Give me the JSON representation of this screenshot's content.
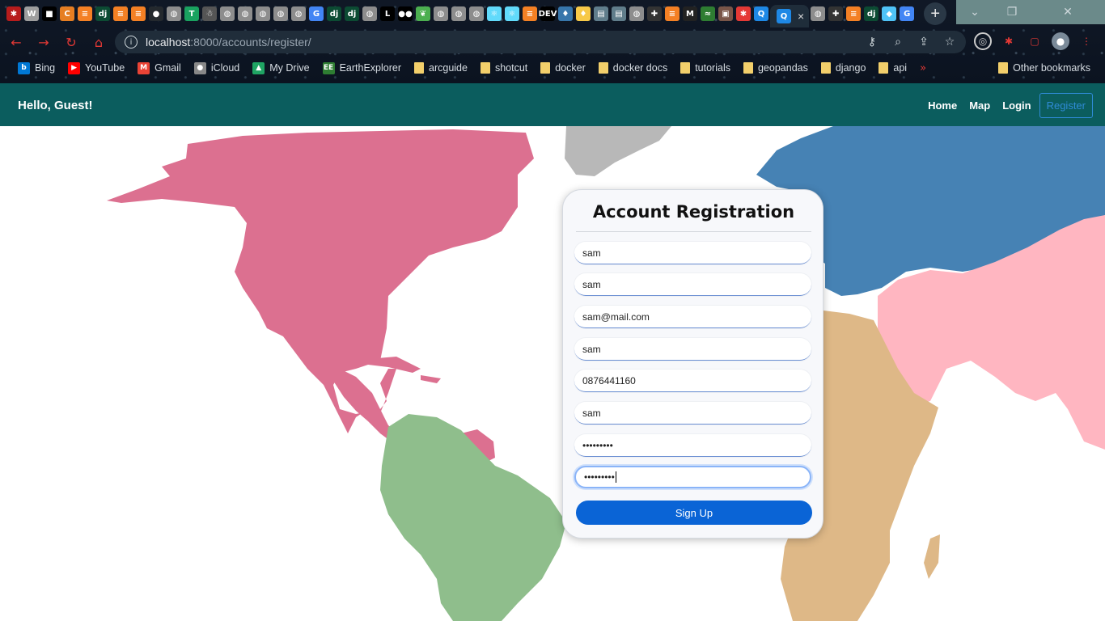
{
  "browser": {
    "tab_icons": [
      {
        "icon": "pin-icon",
        "color": "#b71c1c",
        "glyph": "✱"
      },
      {
        "icon": "wolfram-icon",
        "color": "#9e9e9e",
        "glyph": "W"
      },
      {
        "icon": "square-icon",
        "color": "#000000",
        "glyph": "■"
      },
      {
        "icon": "c-icon",
        "color": "#e67e22",
        "glyph": "C"
      },
      {
        "icon": "stackoverflow-icon",
        "color": "#f48024",
        "glyph": "≡"
      },
      {
        "icon": "django-icon",
        "color": "#0c4b33",
        "glyph": "dj"
      },
      {
        "icon": "stackoverflow-icon",
        "color": "#f48024",
        "glyph": "≡"
      },
      {
        "icon": "stackoverflow-icon",
        "color": "#f48024",
        "glyph": "≡"
      },
      {
        "icon": "github-icon",
        "color": "#24292e",
        "glyph": "●"
      },
      {
        "icon": "globe-icon",
        "color": "#8d8d8d",
        "glyph": "◍"
      },
      {
        "icon": "t-icon",
        "color": "#1aa260",
        "glyph": "T"
      },
      {
        "icon": "ghost-icon",
        "color": "#555555",
        "glyph": "☃"
      },
      {
        "icon": "globe-icon",
        "color": "#8d8d8d",
        "glyph": "◍"
      },
      {
        "icon": "globe-icon",
        "color": "#8d8d8d",
        "glyph": "◍"
      },
      {
        "icon": "globe-icon",
        "color": "#8d8d8d",
        "glyph": "◍"
      },
      {
        "icon": "globe-icon",
        "color": "#8d8d8d",
        "glyph": "◍"
      },
      {
        "icon": "globe-icon",
        "color": "#8d8d8d",
        "glyph": "◍"
      },
      {
        "icon": "google-icon",
        "color": "#4285f4",
        "glyph": "G"
      },
      {
        "icon": "django-icon",
        "color": "#0c4b33",
        "glyph": "dj"
      },
      {
        "icon": "django-icon",
        "color": "#0c4b33",
        "glyph": "dj"
      },
      {
        "icon": "globe-icon",
        "color": "#8d8d8d",
        "glyph": "◍"
      },
      {
        "icon": "l-icon",
        "color": "#000000",
        "glyph": "L"
      },
      {
        "icon": "medium-icon",
        "color": "#000000",
        "glyph": "●●"
      },
      {
        "icon": "leaf-icon",
        "color": "#4caf50",
        "glyph": "❦"
      },
      {
        "icon": "globe-icon",
        "color": "#8d8d8d",
        "glyph": "◍"
      },
      {
        "icon": "globe-icon",
        "color": "#8d8d8d",
        "glyph": "◍"
      },
      {
        "icon": "globe-icon",
        "color": "#8d8d8d",
        "glyph": "◍"
      },
      {
        "icon": "react-icon",
        "color": "#61dafb",
        "glyph": "⚛"
      },
      {
        "icon": "react-icon",
        "color": "#61dafb",
        "glyph": "⚛"
      },
      {
        "icon": "stackoverflow-icon",
        "color": "#f48024",
        "glyph": "≡"
      },
      {
        "icon": "dev-icon",
        "color": "#000000",
        "glyph": "DEV"
      },
      {
        "icon": "python-icon",
        "color": "#3776ab",
        "glyph": "♦"
      },
      {
        "icon": "python-icon",
        "color": "#f7c948",
        "glyph": "♦"
      },
      {
        "icon": "book-icon",
        "color": "#607d8b",
        "glyph": "▤"
      },
      {
        "icon": "book-icon",
        "color": "#607d8b",
        "glyph": "▤"
      },
      {
        "icon": "globe-icon",
        "color": "#8d8d8d",
        "glyph": "◍"
      },
      {
        "icon": "puzzle-icon",
        "color": "#ffffff",
        "glyph": "✚"
      },
      {
        "icon": "stackoverflow-icon",
        "color": "#f48024",
        "glyph": "≡"
      },
      {
        "icon": "m-icon",
        "color": "#222222",
        "glyph": "M"
      },
      {
        "icon": "leaf-icon",
        "color": "#2e7d32",
        "glyph": "≈"
      },
      {
        "icon": "image-icon",
        "color": "#795548",
        "glyph": "▣"
      },
      {
        "icon": "pin-icon",
        "color": "#e53935",
        "glyph": "✱"
      },
      {
        "icon": "q-icon",
        "color": "#1e88e5",
        "glyph": "Q"
      }
    ],
    "tab_icons_after": [
      {
        "icon": "globe-icon",
        "color": "#8d8d8d",
        "glyph": "◍"
      },
      {
        "icon": "puzzle-icon",
        "color": "#ffffff",
        "glyph": "✚"
      },
      {
        "icon": "stackoverflow-icon",
        "color": "#f48024",
        "glyph": "≡"
      },
      {
        "icon": "django-icon",
        "color": "#0c4b33",
        "glyph": "dj"
      },
      {
        "icon": "cube-icon",
        "color": "#4fc3f7",
        "glyph": "◆"
      },
      {
        "icon": "google-icon",
        "color": "#4285f4",
        "glyph": "G"
      }
    ],
    "active_tab_close": "×",
    "new_tab": "+",
    "window_controls": {
      "minimize": "⌄",
      "restore": "❐",
      "close": "✕"
    },
    "url_host": "localhost",
    "url_path": ":8000/accounts/register/",
    "bookmarks": [
      {
        "label": "Bing",
        "icon": "bing-icon",
        "color": "#0078d4",
        "glyph": "b"
      },
      {
        "label": "YouTube",
        "icon": "youtube-icon",
        "color": "#ff0000",
        "glyph": "▶"
      },
      {
        "label": "Gmail",
        "icon": "gmail-icon",
        "color": "#ea4335",
        "glyph": "M"
      },
      {
        "label": "iCloud",
        "icon": "apple-icon",
        "color": "#888888",
        "glyph": "●"
      },
      {
        "label": "My Drive",
        "icon": "drive-icon",
        "color": "#1fa463",
        "glyph": "▲"
      },
      {
        "label": "EarthExplorer",
        "icon": "ee-icon",
        "color": "#2e7d32",
        "glyph": "EE"
      },
      {
        "label": "arcguide",
        "icon": "folder-icon",
        "color": "#f2cf6b",
        "glyph": ""
      },
      {
        "label": "shotcut",
        "icon": "folder-icon",
        "color": "#f2cf6b",
        "glyph": ""
      },
      {
        "label": "docker",
        "icon": "folder-icon",
        "color": "#f2cf6b",
        "glyph": ""
      },
      {
        "label": "docker docs",
        "icon": "folder-icon",
        "color": "#f2cf6b",
        "glyph": ""
      },
      {
        "label": "tutorials",
        "icon": "folder-icon",
        "color": "#f2cf6b",
        "glyph": ""
      },
      {
        "label": "geopandas",
        "icon": "folder-icon",
        "color": "#f2cf6b",
        "glyph": ""
      },
      {
        "label": "django",
        "icon": "folder-icon",
        "color": "#f2cf6b",
        "glyph": ""
      },
      {
        "label": "api",
        "icon": "folder-icon",
        "color": "#f2cf6b",
        "glyph": ""
      }
    ],
    "bookmarks_more": "»",
    "other_bookmarks": "Other bookmarks"
  },
  "navbar": {
    "greeting": "Hello, Guest!",
    "links": [
      "Home",
      "Map",
      "Login"
    ],
    "register": "Register"
  },
  "form": {
    "title": "Account Registration",
    "fields": [
      {
        "name": "first-name-field",
        "value": "sam"
      },
      {
        "name": "last-name-field",
        "value": "sam"
      },
      {
        "name": "email-field",
        "value": "sam@mail.com"
      },
      {
        "name": "username-field",
        "value": "sam"
      },
      {
        "name": "phone-field",
        "value": "0876441160"
      },
      {
        "name": "address-field",
        "value": "sam"
      },
      {
        "name": "password-field",
        "value": "•••••••••"
      },
      {
        "name": "confirm-password-field",
        "value": "•••••••••"
      }
    ],
    "submit": "Sign Up"
  },
  "colors": {
    "navbar": "#0b5d5e",
    "north_america": "#dc7090",
    "south_america": "#8fbe8c",
    "europe": "#4682b4",
    "asia": "#ffb6c1",
    "africa": "#deb887",
    "greenland": "#b8b8b8",
    "button": "#0a64d6"
  }
}
